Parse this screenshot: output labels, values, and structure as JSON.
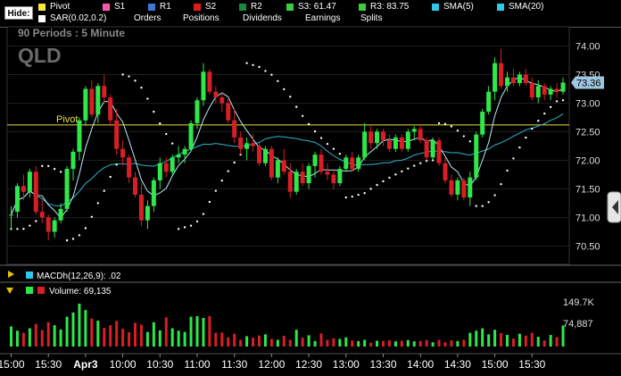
{
  "toolbar": {
    "hide_label": "Hide:",
    "legend_row1": [
      {
        "label": "Pivot",
        "color": "#f5e63c"
      },
      {
        "label": "S1",
        "color": "#ff55aa"
      },
      {
        "label": "R1",
        "color": "#3a78d8"
      },
      {
        "label": "S2",
        "color": "#e11b1b"
      },
      {
        "label": "R2",
        "color": "#1a8a3a"
      },
      {
        "label": "S3: 61.47",
        "color": "#34d040"
      },
      {
        "label": "R3: 83.75",
        "color": "#34d040"
      },
      {
        "label": "SMA(5)",
        "color": "#2ec8e8"
      },
      {
        "label": "SMA(20)",
        "color": "#2ec8e8"
      }
    ],
    "legend_row2": [
      {
        "label": "SAR(0.02,0.2)",
        "color": "#ffffff"
      },
      {
        "label": "Orders",
        "color": null
      },
      {
        "label": "Positions",
        "color": null
      },
      {
        "label": "Dividends",
        "color": null
      },
      {
        "label": "Earnings",
        "color": null
      },
      {
        "label": "Splits",
        "color": null
      }
    ]
  },
  "price_panel": {
    "period_text": "90  Periods : 5 Minute",
    "symbol": "QLD",
    "pivot_label": "Pivot",
    "last_price_tag": "73.36",
    "colors": {
      "up": "#2ee84a",
      "down": "#d81e26",
      "pivot": "#e6e040",
      "sma5": "#b6eef8",
      "sma20": "#2fb4cf",
      "sar": "#ffffff",
      "tag_bg": "#9ec6de"
    }
  },
  "macd_panel": {
    "label": "MACDh(12,26,9): .02",
    "color": "#2ec8e8"
  },
  "volume_panel": {
    "label": "Volume: 69,135",
    "high_label": "149.7K",
    "mid_label": "74,887"
  },
  "chart_data": {
    "type": "candlestick",
    "x_tick_labels": [
      "15:00",
      "15:30",
      "Apr3",
      "10:00",
      "10:30",
      "11:00",
      "11:30",
      "12:00",
      "12:30",
      "13:00",
      "13:30",
      "14:00",
      "14:30",
      "15:00",
      "15:30"
    ],
    "x_tick_bar_index": [
      0,
      6,
      12,
      18,
      24,
      30,
      36,
      42,
      48,
      54,
      60,
      66,
      72,
      78,
      84
    ],
    "y_tick_labels": [
      "74.00",
      "73.50",
      "73.00",
      "72.50",
      "72.00",
      "71.50",
      "71.00",
      "70.50"
    ],
    "y_ticks": [
      74.0,
      73.5,
      73.0,
      72.5,
      72.0,
      71.5,
      71.0,
      70.5
    ],
    "ylim": [
      70.18,
      74.32
    ],
    "pivot": 72.62,
    "candles": [
      {
        "o": 71.05,
        "h": 71.2,
        "l": 70.8,
        "c": 71.05
      },
      {
        "o": 71.1,
        "h": 71.6,
        "l": 71.0,
        "c": 71.55
      },
      {
        "o": 71.55,
        "h": 71.75,
        "l": 71.3,
        "c": 71.45
      },
      {
        "o": 71.45,
        "h": 71.85,
        "l": 71.35,
        "c": 71.8
      },
      {
        "o": 71.8,
        "h": 71.9,
        "l": 71.05,
        "c": 71.1
      },
      {
        "o": 71.1,
        "h": 71.3,
        "l": 70.9,
        "c": 71.0
      },
      {
        "o": 71.0,
        "h": 71.05,
        "l": 70.6,
        "c": 70.75
      },
      {
        "o": 70.75,
        "h": 71.0,
        "l": 70.65,
        "c": 70.95
      },
      {
        "o": 70.95,
        "h": 71.25,
        "l": 70.9,
        "c": 71.15
      },
      {
        "o": 71.15,
        "h": 71.9,
        "l": 71.1,
        "c": 71.85
      },
      {
        "o": 71.85,
        "h": 72.2,
        "l": 71.65,
        "c": 72.15
      },
      {
        "o": 72.15,
        "h": 72.75,
        "l": 72.0,
        "c": 72.7
      },
      {
        "o": 72.7,
        "h": 73.3,
        "l": 72.6,
        "c": 73.25
      },
      {
        "o": 73.25,
        "h": 73.4,
        "l": 72.75,
        "c": 72.8
      },
      {
        "o": 72.8,
        "h": 73.35,
        "l": 72.65,
        "c": 73.3
      },
      {
        "o": 73.3,
        "h": 73.5,
        "l": 73.0,
        "c": 73.1
      },
      {
        "o": 73.1,
        "h": 73.15,
        "l": 72.6,
        "c": 72.7
      },
      {
        "o": 72.7,
        "h": 72.9,
        "l": 72.1,
        "c": 72.2
      },
      {
        "o": 72.2,
        "h": 72.35,
        "l": 71.9,
        "c": 72.05
      },
      {
        "o": 72.05,
        "h": 72.1,
        "l": 71.6,
        "c": 71.7
      },
      {
        "o": 71.7,
        "h": 71.8,
        "l": 71.35,
        "c": 71.4
      },
      {
        "o": 71.4,
        "h": 71.6,
        "l": 70.85,
        "c": 70.95
      },
      {
        "o": 70.95,
        "h": 71.3,
        "l": 70.8,
        "c": 71.2
      },
      {
        "o": 71.2,
        "h": 71.7,
        "l": 71.1,
        "c": 71.65
      },
      {
        "o": 71.65,
        "h": 72.05,
        "l": 71.5,
        "c": 71.95
      },
      {
        "o": 71.95,
        "h": 72.05,
        "l": 71.7,
        "c": 71.8
      },
      {
        "o": 71.8,
        "h": 72.1,
        "l": 71.75,
        "c": 72.05
      },
      {
        "o": 72.05,
        "h": 72.25,
        "l": 71.95,
        "c": 72.1
      },
      {
        "o": 72.1,
        "h": 72.25,
        "l": 71.95,
        "c": 72.2
      },
      {
        "o": 72.2,
        "h": 72.7,
        "l": 72.15,
        "c": 72.65
      },
      {
        "o": 72.65,
        "h": 73.1,
        "l": 72.55,
        "c": 73.05
      },
      {
        "o": 73.05,
        "h": 73.7,
        "l": 72.95,
        "c": 73.55
      },
      {
        "o": 73.55,
        "h": 73.6,
        "l": 73.15,
        "c": 73.2
      },
      {
        "o": 73.2,
        "h": 73.3,
        "l": 73.0,
        "c": 73.1
      },
      {
        "o": 73.1,
        "h": 73.2,
        "l": 72.85,
        "c": 73.0
      },
      {
        "o": 73.0,
        "h": 73.1,
        "l": 72.65,
        "c": 72.7
      },
      {
        "o": 72.7,
        "h": 72.9,
        "l": 72.3,
        "c": 72.4
      },
      {
        "o": 72.4,
        "h": 72.5,
        "l": 72.1,
        "c": 72.2
      },
      {
        "o": 72.2,
        "h": 72.4,
        "l": 72.0,
        "c": 72.3
      },
      {
        "o": 72.3,
        "h": 72.45,
        "l": 72.15,
        "c": 72.25
      },
      {
        "o": 72.25,
        "h": 72.3,
        "l": 71.9,
        "c": 71.95
      },
      {
        "o": 71.95,
        "h": 72.25,
        "l": 71.9,
        "c": 72.2
      },
      {
        "o": 72.2,
        "h": 72.25,
        "l": 71.65,
        "c": 71.7
      },
      {
        "o": 71.7,
        "h": 72.05,
        "l": 71.6,
        "c": 72.0
      },
      {
        "o": 72.0,
        "h": 72.2,
        "l": 71.75,
        "c": 71.8
      },
      {
        "o": 71.8,
        "h": 71.95,
        "l": 71.35,
        "c": 71.45
      },
      {
        "o": 71.45,
        "h": 71.85,
        "l": 71.4,
        "c": 71.8
      },
      {
        "o": 71.8,
        "h": 71.95,
        "l": 71.55,
        "c": 71.6
      },
      {
        "o": 71.6,
        "h": 71.95,
        "l": 71.5,
        "c": 71.9
      },
      {
        "o": 71.9,
        "h": 72.15,
        "l": 71.7,
        "c": 72.1
      },
      {
        "o": 72.1,
        "h": 72.2,
        "l": 71.75,
        "c": 71.8
      },
      {
        "o": 71.8,
        "h": 71.95,
        "l": 71.65,
        "c": 71.75
      },
      {
        "o": 71.75,
        "h": 71.85,
        "l": 71.5,
        "c": 71.6
      },
      {
        "o": 71.6,
        "h": 71.9,
        "l": 71.55,
        "c": 71.85
      },
      {
        "o": 71.85,
        "h": 72.1,
        "l": 71.8,
        "c": 72.05
      },
      {
        "o": 72.05,
        "h": 72.15,
        "l": 71.8,
        "c": 71.85
      },
      {
        "o": 71.85,
        "h": 72.1,
        "l": 71.8,
        "c": 72.05
      },
      {
        "o": 72.05,
        "h": 72.65,
        "l": 72.0,
        "c": 72.5
      },
      {
        "o": 72.5,
        "h": 72.6,
        "l": 72.2,
        "c": 72.3
      },
      {
        "o": 72.3,
        "h": 72.55,
        "l": 72.2,
        "c": 72.5
      },
      {
        "o": 72.5,
        "h": 72.55,
        "l": 72.25,
        "c": 72.35
      },
      {
        "o": 72.35,
        "h": 72.45,
        "l": 72.15,
        "c": 72.2
      },
      {
        "o": 72.2,
        "h": 72.45,
        "l": 72.15,
        "c": 72.4
      },
      {
        "o": 72.4,
        "h": 72.45,
        "l": 72.15,
        "c": 72.2
      },
      {
        "o": 72.2,
        "h": 72.55,
        "l": 72.15,
        "c": 72.5
      },
      {
        "o": 72.5,
        "h": 72.6,
        "l": 72.35,
        "c": 72.55
      },
      {
        "o": 72.55,
        "h": 72.6,
        "l": 72.3,
        "c": 72.35
      },
      {
        "o": 72.35,
        "h": 72.4,
        "l": 72.0,
        "c": 72.05
      },
      {
        "o": 72.05,
        "h": 72.4,
        "l": 72.0,
        "c": 72.35
      },
      {
        "o": 72.35,
        "h": 72.4,
        "l": 71.9,
        "c": 71.95
      },
      {
        "o": 71.95,
        "h": 72.05,
        "l": 71.6,
        "c": 71.65
      },
      {
        "o": 71.65,
        "h": 71.75,
        "l": 71.35,
        "c": 71.4
      },
      {
        "o": 71.4,
        "h": 71.7,
        "l": 71.3,
        "c": 71.65
      },
      {
        "o": 71.65,
        "h": 71.7,
        "l": 71.3,
        "c": 71.35
      },
      {
        "o": 71.35,
        "h": 71.8,
        "l": 71.2,
        "c": 71.7
      },
      {
        "o": 71.7,
        "h": 72.5,
        "l": 71.65,
        "c": 72.45
      },
      {
        "o": 72.45,
        "h": 72.9,
        "l": 72.4,
        "c": 72.85
      },
      {
        "o": 72.85,
        "h": 73.3,
        "l": 72.8,
        "c": 73.2
      },
      {
        "o": 73.2,
        "h": 73.8,
        "l": 73.05,
        "c": 73.7
      },
      {
        "o": 73.7,
        "h": 73.95,
        "l": 73.25,
        "c": 73.3
      },
      {
        "o": 73.3,
        "h": 73.55,
        "l": 73.2,
        "c": 73.45
      },
      {
        "o": 73.45,
        "h": 73.6,
        "l": 73.3,
        "c": 73.35
      },
      {
        "o": 73.35,
        "h": 73.55,
        "l": 73.3,
        "c": 73.5
      },
      {
        "o": 73.5,
        "h": 73.6,
        "l": 73.3,
        "c": 73.35
      },
      {
        "o": 73.35,
        "h": 73.45,
        "l": 73.05,
        "c": 73.1
      },
      {
        "o": 73.1,
        "h": 73.4,
        "l": 73.0,
        "c": 73.3
      },
      {
        "o": 73.3,
        "h": 73.35,
        "l": 73.05,
        "c": 73.15
      },
      {
        "o": 73.15,
        "h": 73.3,
        "l": 73.05,
        "c": 73.25
      },
      {
        "o": 73.25,
        "h": 73.35,
        "l": 73.1,
        "c": 73.2
      },
      {
        "o": 73.2,
        "h": 73.45,
        "l": 73.15,
        "c": 73.36
      }
    ],
    "volume_max": 149700,
    "volumes": [
      66000,
      52000,
      45000,
      60000,
      74000,
      54000,
      80000,
      70000,
      56000,
      98000,
      112000,
      141000,
      120000,
      92000,
      85000,
      61000,
      70000,
      84000,
      58000,
      47000,
      78000,
      72000,
      48000,
      80000,
      53000,
      96000,
      60000,
      52000,
      48000,
      98000,
      100000,
      94000,
      100000,
      45000,
      46000,
      30000,
      42000,
      22000,
      34000,
      29000,
      36000,
      40000,
      25000,
      22000,
      35000,
      22000,
      55000,
      29000,
      37000,
      18000,
      43000,
      22000,
      27000,
      25000,
      30000,
      20000,
      18000,
      22000,
      12000,
      19000,
      18000,
      20000,
      17000,
      19000,
      21000,
      17000,
      18000,
      21000,
      14000,
      22000,
      14000,
      20000,
      18000,
      22000,
      45000,
      52000,
      60000,
      40000,
      55000,
      44000,
      38000,
      26000,
      42000,
      36000,
      45000,
      32000,
      20000,
      38000,
      31000,
      69135
    ]
  }
}
